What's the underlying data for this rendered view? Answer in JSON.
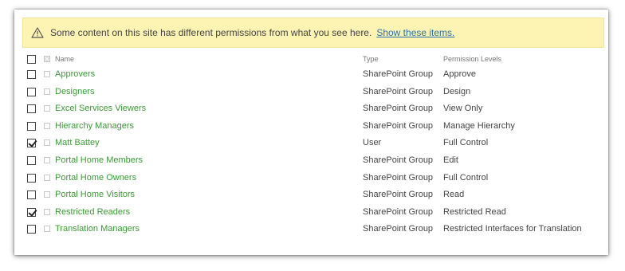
{
  "banner": {
    "message": "Some content on this site has different permissions from what you see here.",
    "link_text": "Show these items.",
    "icon": "warning-icon"
  },
  "columns": {
    "name": "Name",
    "type": "Type",
    "permission": "Permission Levels"
  },
  "rows": [
    {
      "name": "Approvers",
      "type": "SharePoint Group",
      "permission": "Approve",
      "checked": false
    },
    {
      "name": "Designers",
      "type": "SharePoint Group",
      "permission": "Design",
      "checked": false
    },
    {
      "name": "Excel Services Viewers",
      "type": "SharePoint Group",
      "permission": "View Only",
      "checked": false
    },
    {
      "name": "Hierarchy Managers",
      "type": "SharePoint Group",
      "permission": "Manage Hierarchy",
      "checked": false
    },
    {
      "name": "Matt Battey",
      "type": "User",
      "permission": "Full Control",
      "checked": true
    },
    {
      "name": "Portal Home Members",
      "type": "SharePoint Group",
      "permission": "Edit",
      "checked": false
    },
    {
      "name": "Portal Home Owners",
      "type": "SharePoint Group",
      "permission": "Full Control",
      "checked": false
    },
    {
      "name": "Portal Home Visitors",
      "type": "SharePoint Group",
      "permission": "Read",
      "checked": false
    },
    {
      "name": "Restricted Readers",
      "type": "SharePoint Group",
      "permission": "Restricted Read",
      "checked": true
    },
    {
      "name": "Translation Managers",
      "type": "SharePoint Group",
      "permission": "Restricted Interfaces for Translation",
      "checked": false
    }
  ],
  "colors": {
    "banner_bg": "#fdf4b3",
    "link": "#2a6fb5",
    "name_green": "#3b9a35"
  }
}
